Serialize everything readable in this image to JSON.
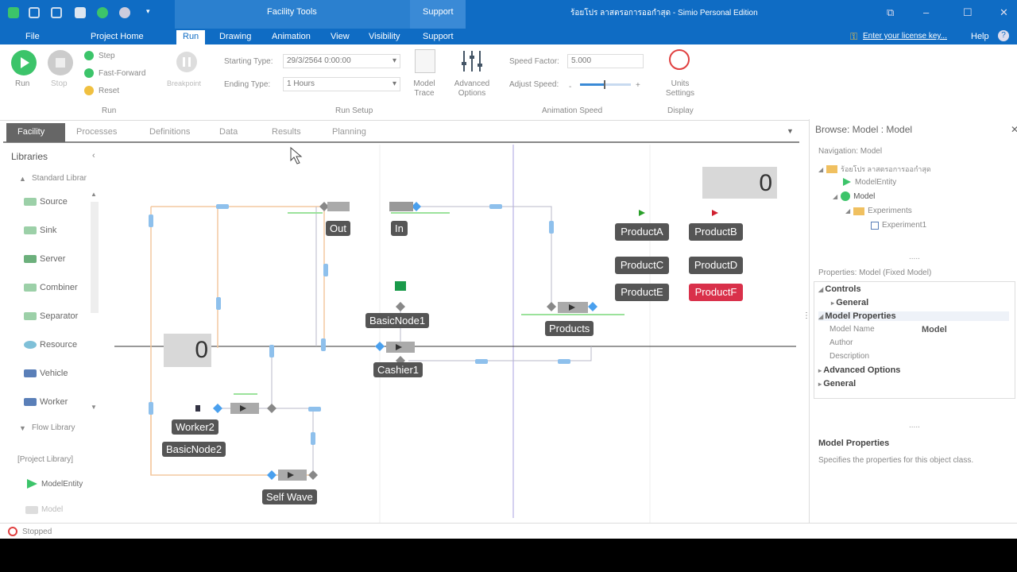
{
  "titlebar": {
    "context_facility": "Facility Tools",
    "context_support": "Support",
    "app_title": "ร้อยโปร ลาสตรอการออกำสุด - Simio Personal Edition",
    "license_link": "Enter your license key...",
    "help": "Help"
  },
  "tabs": [
    "File",
    "Project Home",
    "Run",
    "Drawing",
    "Animation",
    "View",
    "Visibility",
    "Support"
  ],
  "ribbon": {
    "run": "Run",
    "stop": "Stop",
    "step": "Step",
    "fast_forward": "Fast-Forward",
    "reset": "Reset",
    "breakpoint": "Breakpoint",
    "starting_type_label": "Starting Type:",
    "starting_type_value": "29/3/2564 0:00:00",
    "ending_type_label": "Ending Type:",
    "ending_type_value": "1 Hours",
    "model_trace": "Model Trace",
    "advanced_options": "Advanced Options",
    "speed_factor_label": "Speed Factor:",
    "speed_factor_value": "5.000",
    "adjust_speed_label": "Adjust Speed:",
    "units_settings": "Units Settings",
    "group_run": "Run",
    "group_run_setup": "Run Setup",
    "group_animation_speed": "Animation Speed",
    "group_display": "Display"
  },
  "doc_tabs": [
    "Facility",
    "Processes",
    "Definitions",
    "Data",
    "Results",
    "Planning"
  ],
  "libraries": {
    "title": "Libraries",
    "standard_library": "Standard Librar",
    "items": [
      "Source",
      "Sink",
      "Server",
      "Combiner",
      "Separator",
      "Resource",
      "Vehicle",
      "Worker"
    ],
    "flow_library": "Flow Library",
    "project_library": "[Project Library]",
    "project_items": [
      "ModelEntity",
      "Model"
    ]
  },
  "canvas": {
    "counter_top": "0",
    "counter_mid": "0",
    "nodes": {
      "out": "Out",
      "in": "In",
      "basicnode1": "BasicNode1",
      "cashier1": "Cashier1",
      "products": "Products",
      "worker2": "Worker2",
      "basicnode2": "BasicNode2",
      "self_wave": "Self Wave"
    },
    "products": [
      "ProductA",
      "ProductB",
      "ProductC",
      "ProductD",
      "ProductE",
      "ProductF"
    ]
  },
  "right_panel": {
    "browse_title": "Browse: Model : Model",
    "navigation": "Navigation: Model",
    "tree": [
      "ร้อยโปร ลาสตรอการออกำสุด",
      "ModelEntity",
      "Model",
      "Experiments",
      "Experiment1"
    ],
    "properties_title": "Properties: Model (Fixed Model)",
    "cat_controls": "Controls",
    "cat_general_sub": "General",
    "cat_model_props": "Model Properties",
    "prop_model_name_label": "Model Name",
    "prop_model_name_value": "Model",
    "prop_author": "Author",
    "prop_description": "Description",
    "cat_advanced": "Advanced Options",
    "cat_general": "General",
    "help_title": "Model Properties",
    "help_text": "Specifies the properties for this object class."
  },
  "status": {
    "text": "Stopped"
  },
  "colors": {
    "title_blue": "#0f6cc4",
    "product_highlight": "#d9304a",
    "node_gray": "#555555"
  }
}
